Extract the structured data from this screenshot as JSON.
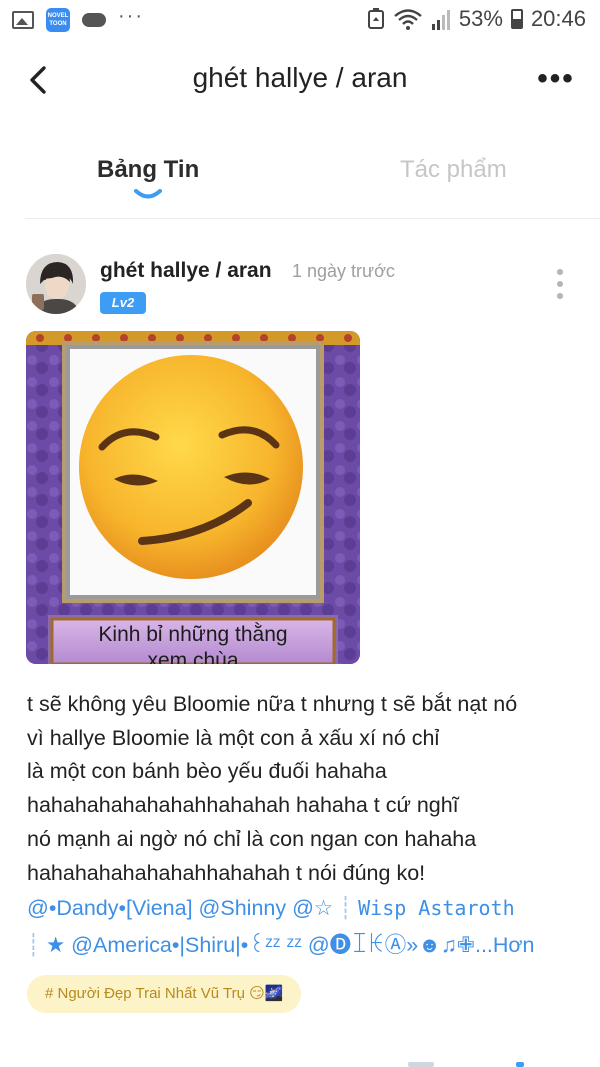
{
  "status_bar": {
    "battery": "53%",
    "time": "20:46",
    "icons": [
      "gallery-icon",
      "noveltoon-app-icon",
      "cloud-icon",
      "more-notifications-icon",
      "data-saver-icon",
      "wifi-icon",
      "signal-icon",
      "battery-icon"
    ],
    "noveltoon_label": "NOVEL TOON"
  },
  "header": {
    "title": "ghét hallye / aran",
    "back_icon": "back-arrow-icon",
    "more_icon": "more-horizontal-icon"
  },
  "tabs": [
    {
      "label": "Bảng Tin",
      "active": true
    },
    {
      "label": "Tác phẩm",
      "active": false
    }
  ],
  "colors": {
    "accent": "#3d9cf4",
    "mention": "#3e8fe6",
    "tab_inactive": "#c6c6c6",
    "tag_bg": "#fdf3c8",
    "tag_text": "#b58b1e"
  },
  "post": {
    "author": "ghét hallye / aran",
    "time": "1 ngày trước",
    "level": "Lv2",
    "image_caption_line1": "Kinh bỉ những thằng",
    "image_caption_line2": "xem chùa",
    "body_lines": [
      "t sẽ không yêu Bloomie nữa t  nhưng t sẽ bắt nạt nó",
      "vì hallye Bloomie là một con ả xấu xí nó chỉ",
      "là một con bánh bèo yếu đuối hahaha",
      "hahahahahahahahhahahah hahaha t cứ nghĩ",
      "nó mạnh ai ngờ nó chỉ là con ngan con hahaha",
      "hahahahahahahahhahahah t nói đúng ko!"
    ],
    "mentions_line1": {
      "part1": "@•Dandy•[Viena] @Shinny @☆",
      "sep": "┊",
      "part2": "𝚆𝚒𝚜𝚙 𝙰𝚜𝚝𝚊𝚛𝚘𝚝𝚑"
    },
    "mentions_line2": {
      "sep": "┊",
      "text": "★ @America•|Shiru|•꒰ᶻᶻ ᶻᶻ @🅓ꀤꀘⒶ»☻♫✙",
      "more": "...Hơn"
    },
    "tag": "# Người Đẹp Trai Nhất Vũ Trụ 😏🌌"
  }
}
